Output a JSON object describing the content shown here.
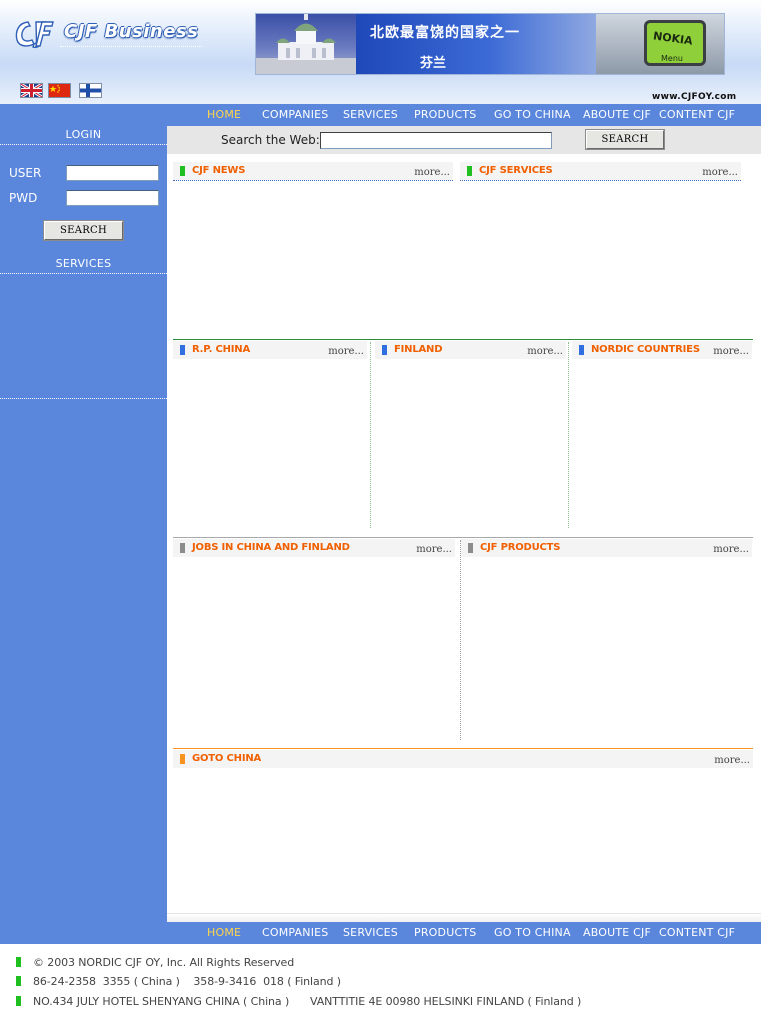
{
  "header": {
    "brand": "CJF Business",
    "banner": {
      "text_line_1": "北欧最富饶的国家之一",
      "text_line_2": "芬兰",
      "phone_brand": "NOKIA",
      "phone_menu": "Menu"
    },
    "flags": [
      {
        "name": "uk-flag-icon"
      },
      {
        "name": "china-flag-icon"
      },
      {
        "name": "finland-flag-icon"
      }
    ],
    "url": "www.CJFOY.com"
  },
  "nav": {
    "items": [
      "HOME",
      "COMPANIES",
      "SERVICES",
      "PRODUCTS",
      "GO TO CHINA",
      "ABOUTE CJF",
      "CONTENT CJF"
    ],
    "active_color": "#ffd64a"
  },
  "search": {
    "label": "Search the Web:",
    "value": "",
    "button": "SEARCH"
  },
  "sidebar": {
    "login_title": "LOGIN",
    "user_label": "USER",
    "user_value": "",
    "pwd_label": "PWD",
    "pwd_value": "",
    "search_button": "SEARCH",
    "services_title": "SERVICES",
    "background": "#5a86dc"
  },
  "sections": {
    "news": {
      "title": "CJF NEWS",
      "more": "more..."
    },
    "services": {
      "title": "CJF SERVICES",
      "more": "more..."
    },
    "china": {
      "title": "R.P. CHINA",
      "more": "more..."
    },
    "finland": {
      "title": "FINLAND",
      "more": "more..."
    },
    "nordic": {
      "title": "NORDIC COUNTRIES",
      "more": "more..."
    },
    "jobs": {
      "title": "JOBS IN CHINA AND FINLAND",
      "more": "more..."
    },
    "products": {
      "title": "CJF PRODUCTS",
      "more": "more..."
    },
    "gotochina": {
      "title": "GOTO CHINA",
      "more": "more..."
    }
  },
  "colors": {
    "title_orange": "#f06000",
    "marker_green": "#1fbf1f",
    "marker_blue": "#2f6fe0",
    "marker_gray": "#8c8c8c",
    "marker_orange": "#f7931e"
  },
  "footer": {
    "copyright": "© 2003 NORDIC CJF OY, Inc. All Rights Reserved",
    "phones": "86-24-2358  3355 ( China )    358-9-3416  018 ( Finland )",
    "address_cn": "NO.434 JULY HOTEL SHENYANG CHINA ( China )",
    "address_fi": "VANTTITIE  4E 00980 HELSINKI FINLAND ( Finland )"
  }
}
